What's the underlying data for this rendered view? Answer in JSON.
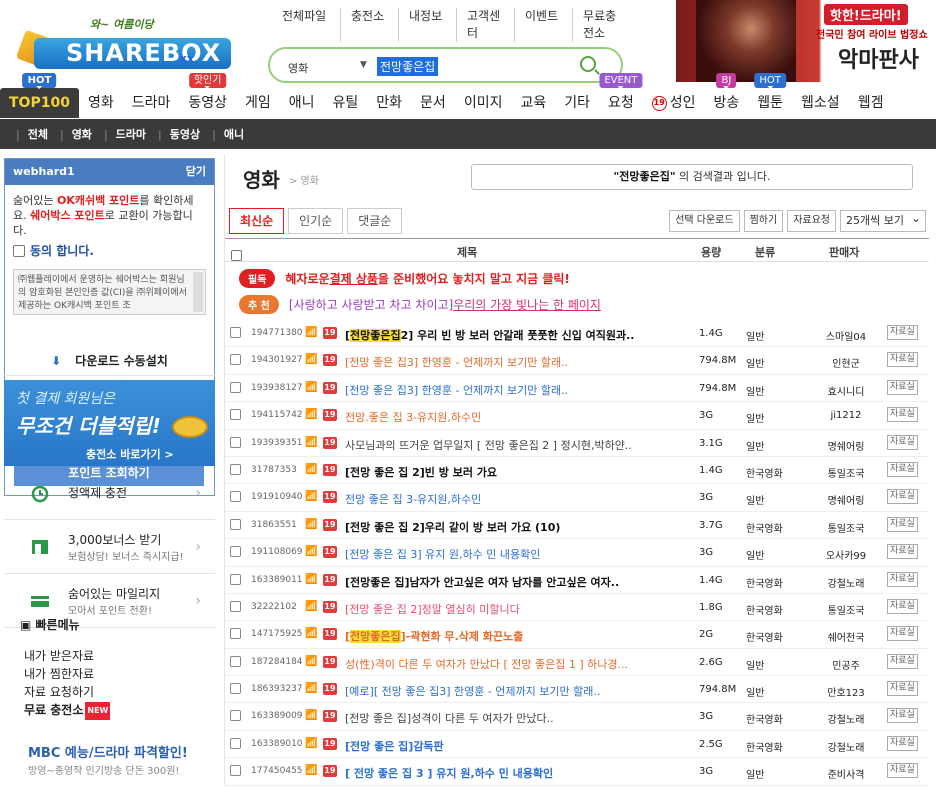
{
  "header": {
    "logo_tagline": "와~ 여름이당",
    "logo_text": "SHAREBOX",
    "logo_suffix": "xx",
    "top_links": [
      "전체파일",
      "충전소",
      "내정보",
      "고객센터",
      "이벤트",
      "무료충전소"
    ],
    "search": {
      "category": "영화",
      "query": "전망좋은집"
    },
    "ad": {
      "hot": "핫한!드라마!",
      "sub": "전국민 참여 라이브 법정쇼",
      "title": "악마판사"
    }
  },
  "gnb": [
    {
      "label": "TOP100",
      "badge": "HOT",
      "badge_type": "hot"
    },
    {
      "label": "영화"
    },
    {
      "label": "드라마"
    },
    {
      "label": "동영상",
      "badge": "핫인기",
      "badge_type": "red"
    },
    {
      "label": "게임"
    },
    {
      "label": "애니"
    },
    {
      "label": "유틸"
    },
    {
      "label": "만화"
    },
    {
      "label": "문서"
    },
    {
      "label": "이미지"
    },
    {
      "label": "교육"
    },
    {
      "label": "기타"
    },
    {
      "label": "요청",
      "badge": "EVENT",
      "badge_type": "event"
    },
    {
      "label": "성인",
      "age": "19"
    },
    {
      "label": "방송",
      "badge": "BJ",
      "badge_type": "bj"
    },
    {
      "label": "웹툰",
      "badge": "HOT",
      "badge_type": "hot"
    },
    {
      "label": "웹소설"
    },
    {
      "label": "웹겜"
    }
  ],
  "subnav": [
    "전체",
    "영화",
    "드라마",
    "동영상",
    "애니"
  ],
  "sidebar": {
    "user": "webhard1",
    "close": "닫기",
    "msg1": "숨어있는 ",
    "msg_ok": "OK캐쉬백 포인트",
    "msg2": "를 확인하세요. ",
    "msg_sb": "쉐어박스 포인트",
    "msg3": "로 교환이 가능합니다.",
    "agree": "동의 합니다.",
    "terms": "㈜웹플레이에서 운영하는 쉐어박스는 회원님의 암호화된 본인인증 값(CI)을 ㈜위페이에서 제공하는 OK캐시백 포인트 조",
    "point_btn": "포인트 조회하기",
    "download": "다운로드 수동설치",
    "promo": {
      "line1": "첫 결제 회원님은",
      "line2": "무조건 더블적립!",
      "link": "충전소 바로가기 >"
    },
    "rows": [
      {
        "t1": "정액제 충전",
        "t2": ""
      },
      {
        "t1": "3,000보너스 받기",
        "t2": "보험상담! 보너스 즉시지급!"
      },
      {
        "t1": "숨어있는 마일리지",
        "t2": "모아서 포인트 전환!"
      }
    ],
    "quick_title": "빠른메뉴",
    "quick": [
      "내가 받은자료",
      "내가 찜한자료",
      "자료 요청하기",
      "무료 충전소"
    ],
    "new": "NEW",
    "mbc": "MBC 예능/드라마 파격할인!",
    "mbc_sub": "방영~종영작 인기방송 단돈 300원!"
  },
  "main": {
    "title": "영화",
    "crumb": "> 영화",
    "result_query": "\"전망좋은집\"",
    "result_suffix": " 의 검색결과 입니다.",
    "tabs": [
      "최신순",
      "인기순",
      "댓글순"
    ],
    "tools": [
      "선택 다운로드",
      "찜하기",
      "자료요청"
    ],
    "per_page": "25개씩 보기",
    "columns": {
      "title": "제목",
      "size": "용량",
      "class": "분류",
      "seller": "판매자"
    },
    "notices": [
      {
        "badge": "필독",
        "text": "혜자로운 ",
        "hl": "결제 상품",
        "text2": "을 준비했어요 놓치지 말고 지금 클릭!"
      },
      {
        "badge": "추 천",
        "text": "[사랑하고 사랑받고 차고 차이고] ",
        "hl": "우리의 가장 빛나는 한 페이지"
      }
    ],
    "detail_label": "자료실",
    "rows": [
      {
        "id": "194771380",
        "title": "[전망좋은집2] 우리 빈 방 보러 안갈래 풋풋한 신입 여직원과..",
        "size": "1.4G",
        "cls": "일반",
        "seller": "스마일04",
        "color": "#111",
        "bold": true,
        "hl": "전망좋은집"
      },
      {
        "id": "194301927",
        "title": "[전망 좋은 집3] 한영훈 - 언제까지 보기만 할래..",
        "size": "794.8M",
        "cls": "일반",
        "seller": "인현군",
        "color": "#e36a2a",
        "bold": false
      },
      {
        "id": "193938127",
        "title": "[전망 좋은 집3] 한영훈 - 언제까지 보기만 할래..",
        "size": "794.8M",
        "cls": "일반",
        "seller": "효시니디",
        "color": "#2b6fcf",
        "bold": false
      },
      {
        "id": "194115742",
        "title": "전망.좋은 집 3-유지원,하수민",
        "size": "3G",
        "cls": "일반",
        "seller": "ji1212",
        "color": "#e36a2a",
        "bold": false
      },
      {
        "id": "193939351",
        "title": "사모님과의 뜨거운 업무일지 [ 전망 좋은집 2 ] 정시현,박하얀..",
        "size": "3.1G",
        "cls": "일반",
        "seller": "명쉐어링",
        "color": "#444",
        "bold": false
      },
      {
        "id": "31787353",
        "title": "[전망 좋은 집 2]빈 방 보러 가요",
        "size": "1.4G",
        "cls": "한국영화",
        "seller": "통일조국",
        "color": "#111",
        "bold": true
      },
      {
        "id": "191910940",
        "title": "전망 좋은 집 3-유지원,하수민",
        "size": "3G",
        "cls": "일반",
        "seller": "명쉐어링",
        "color": "#2b6fcf",
        "bold": false
      },
      {
        "id": "31863551",
        "title": "[전망 좋은 집 2]우리 같이 방 보러 가요 (10)",
        "size": "3.7G",
        "cls": "한국영화",
        "seller": "통일조국",
        "color": "#111",
        "bold": true
      },
      {
        "id": "191108069",
        "title": "[전망 좋은 집 3] 유지 원,하수 민 내용확인",
        "size": "3G",
        "cls": "일반",
        "seller": "오사카99",
        "color": "#2b6fcf",
        "bold": false
      },
      {
        "id": "163389011",
        "title": "[전망좋은 집]남자가 안고싶은 여자 남자를 안고싶은 여자..",
        "size": "1.4G",
        "cls": "한국영화",
        "seller": "강철노래",
        "color": "#111",
        "bold": true
      },
      {
        "id": "32222102",
        "title": "[전망 좋은 집 2]정말 열심히 미할니다",
        "size": "1.8G",
        "cls": "한국영화",
        "seller": "통일조국",
        "color": "#e05070",
        "bold": false
      },
      {
        "id": "147175925",
        "title": "[전망좋은집]-곽현화 무.삭제 화끈노출",
        "size": "2G",
        "cls": "한국영화",
        "seller": "쉐어천국",
        "color": "#e36a2a",
        "bold": true,
        "hl": "전망좋은집"
      },
      {
        "id": "187284184",
        "title": "성(性)격이 다른 두 여자가 만났다 [ 전망 좋은집 1 ] 하나경...",
        "size": "2.6G",
        "cls": "일반",
        "seller": "민공주",
        "color": "#e36a2a",
        "bold": false
      },
      {
        "id": "186393237",
        "title": "[예로][ 전망 좋은 집3] 한영훈 - 언제까지 보기만 할래..",
        "size": "794.8M",
        "cls": "일반",
        "seller": "만호123",
        "color": "#2b6fcf",
        "bold": false
      },
      {
        "id": "163389009",
        "title": "[전망 좋은 집]성격이 다른 두 여자가 만났다..",
        "size": "3G",
        "cls": "한국영화",
        "seller": "강철노래",
        "color": "#444",
        "bold": false
      },
      {
        "id": "163389010",
        "title": "[전망 좋은 집]감독판",
        "size": "2.5G",
        "cls": "한국영화",
        "seller": "강철노래",
        "color": "#2b6fcf",
        "bold": true
      },
      {
        "id": "177450455",
        "title": "[ 전망 좋은 집 3 ] 유지 원,하수 민 내용확인",
        "size": "3G",
        "cls": "일반",
        "seller": "준비사격",
        "color": "#2b6fcf",
        "bold": true
      }
    ]
  }
}
